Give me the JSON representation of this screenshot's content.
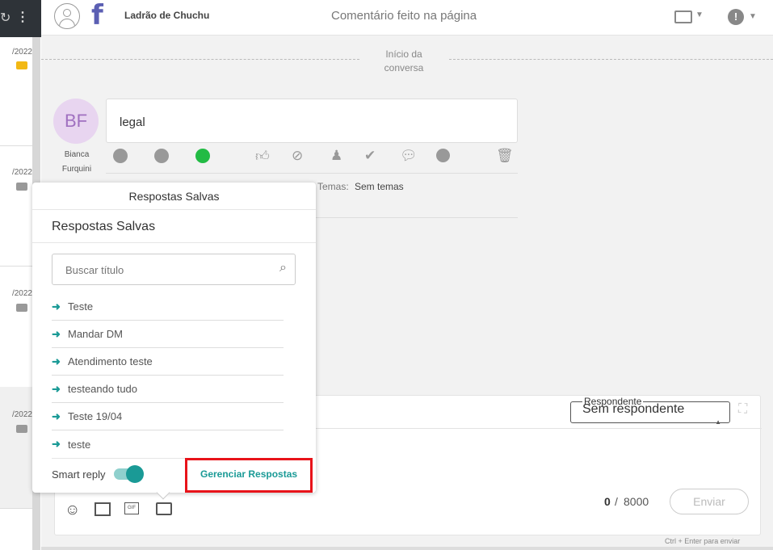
{
  "header": {
    "page_name": "Ladrão de Chuchu",
    "title": "Comentário feito na página"
  },
  "left_list": {
    "dates": [
      "/2022",
      "/2022",
      "/2022",
      "/2022"
    ]
  },
  "conversation": {
    "start_label_line1": "Início da",
    "start_label_line2": "conversa",
    "avatar_initials": "BF",
    "author_line1": "Bianca",
    "author_line2": "Furquini",
    "message": "legal",
    "topics_label": "Temas:",
    "topics_value": "Sem temas"
  },
  "popup": {
    "tab_title": "Respostas Salvas",
    "heading": "Respostas Salvas",
    "search_placeholder": "Buscar título",
    "items": [
      "Teste",
      "Mandar DM",
      "Atendimento teste",
      "testeando tudo",
      "Teste 19/04",
      "teste"
    ],
    "smart_reply_label": "Smart reply",
    "smart_reply_on": true,
    "manage_label": "Gerenciar Respostas"
  },
  "composer": {
    "respondent_legend": "Respondente",
    "respondent_value": "Sem respondente",
    "char_count": "0",
    "char_sep": "/",
    "char_max": "8000",
    "send_label": "Enviar",
    "hint": "Ctrl + Enter para enviar"
  },
  "colors": {
    "accent": "#1a9a96",
    "highlight": "#e8131a",
    "facebook": "#5b5fb3",
    "avatar_bg": "#e8d5f0",
    "avatar_text": "#a070c0"
  }
}
